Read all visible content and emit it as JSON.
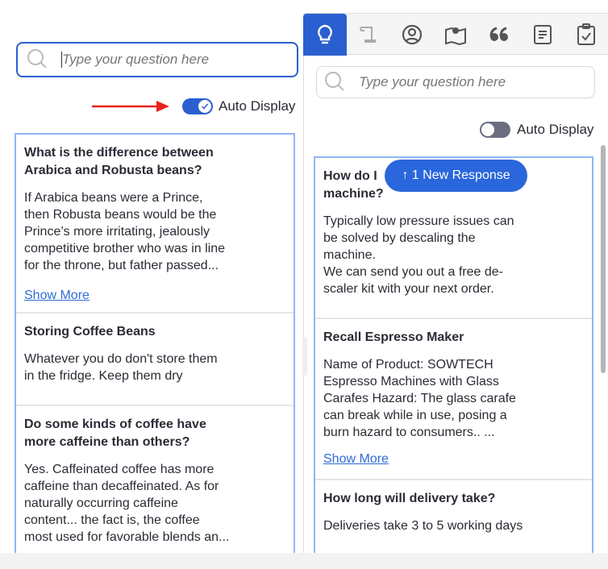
{
  "left": {
    "search": {
      "placeholder": "Type your question here"
    },
    "auto_display": {
      "label": "Auto Display",
      "on": true
    },
    "annotation": "red-arrow",
    "items": [
      {
        "title": "What is the difference between\nArabica and Robusta beans?",
        "body": "If Arabica beans were a Prince,\nthen Robusta beans would be the\nPrince’s more irritating, jealously\ncompetitive brother who was in line\nfor the throne, but father passed...",
        "link": "Show More"
      },
      {
        "title": "Storing Coffee Beans",
        "body": "Whatever you do don't store them\nin the fridge. Keep them dry"
      },
      {
        "title": "Do some kinds of coffee have\nmore caffeine than others?",
        "body": "Yes. Caffeinated coffee has more\ncaffeine than decaffeinated. As for\nnaturally occurring caffeine\ncontent... the fact is, the coffee\nmost used for favorable blends an..."
      }
    ]
  },
  "right": {
    "tabs": [
      {
        "icon": "lightbulb-icon",
        "active": true
      },
      {
        "icon": "scroll-icon"
      },
      {
        "icon": "user-circle-icon"
      },
      {
        "icon": "map-pin-icon"
      },
      {
        "icon": "quote-icon"
      },
      {
        "icon": "document-icon"
      },
      {
        "icon": "clipboard-check-icon"
      }
    ],
    "search": {
      "placeholder": "Type your question here"
    },
    "auto_display": {
      "label": "Auto Display",
      "on": false
    },
    "new_response": "↑ 1 New Response",
    "items": [
      {
        "title": "How do I \nmachine?",
        "body": "Typically low pressure issues can\nbe solved by descaling the\nmachine.\nWe can send you out a free de-\nscaler kit with your next order."
      },
      {
        "title": "Recall Espresso Maker",
        "body": "Name of Product: SOWTECH\nEspresso Machines with Glass\nCarafes Hazard: The glass carafe\ncan break while in use, posing a\nburn hazard to consumers..   ...",
        "link": "Show More"
      },
      {
        "title": "How long will delivery take?",
        "body": "Deliveries take 3 to 5 working days"
      }
    ]
  },
  "colors": {
    "accent": "#2a5fcf",
    "toggle_off": "#6b6e80",
    "arrow": "#e8231b"
  }
}
